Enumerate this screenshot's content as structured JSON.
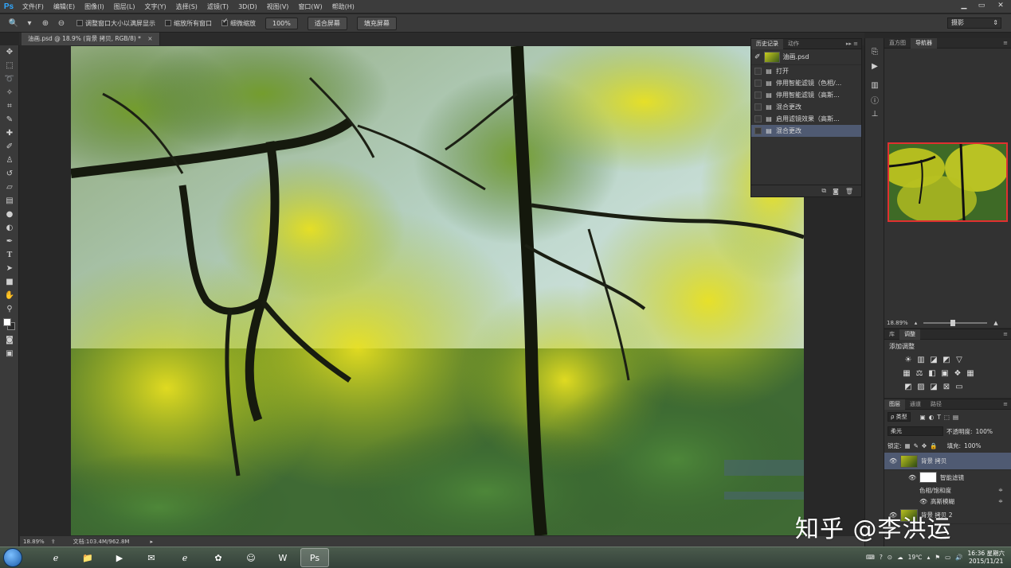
{
  "app": {
    "logo": "Ps",
    "menu": [
      "文件(F)",
      "编辑(E)",
      "图像(I)",
      "图层(L)",
      "文字(Y)",
      "选择(S)",
      "滤镜(T)",
      "3D(D)",
      "视图(V)",
      "窗口(W)",
      "帮助(H)"
    ],
    "window_controls": [
      "▁",
      "▭",
      "✕"
    ]
  },
  "options": {
    "tool_icon": "zoom-icon",
    "resize_windows_label": "调整窗口大小以满屏显示",
    "resize_windows_checked": false,
    "zoom_all_label": "缩放所有窗口",
    "zoom_all_checked": false,
    "scrubby_zoom_label": "细微缩放",
    "scrubby_zoom_checked": true,
    "btn_100": "100%",
    "btn_fit": "适合屏幕",
    "btn_fill": "填充屏幕",
    "workspace": "摄影"
  },
  "document": {
    "tab_title": "油画.psd @ 18.9% (背景 拷贝, RGB/8) *",
    "close": "×"
  },
  "status": {
    "zoom": "18.89%",
    "doc_size": "文档:103.4M/962.8M"
  },
  "history": {
    "tabs": [
      "历史记录",
      "动作"
    ],
    "snapshot": "油画.psd",
    "items": [
      {
        "label": "打开",
        "active": false
      },
      {
        "label": "停用智能滤镜（色相/...",
        "active": false
      },
      {
        "label": "停用智能滤镜（高斯...",
        "active": false
      },
      {
        "label": "混合更改",
        "active": false
      },
      {
        "label": "启用滤镜效果（高斯...",
        "active": false
      },
      {
        "label": "混合更改",
        "active": true
      }
    ]
  },
  "navigator": {
    "tabs": [
      "直方图",
      "导航器"
    ],
    "zoom": "18.89%"
  },
  "adjustments": {
    "tabs": [
      "库",
      "调整"
    ],
    "title": "添加调整"
  },
  "layers": {
    "tabs": [
      "图层",
      "通道",
      "路径"
    ],
    "filter_kind": "ρ 类型",
    "blend_mode": "柔光",
    "opacity_label": "不透明度:",
    "opacity": "100%",
    "lock_label": "锁定:",
    "fill_label": "填充:",
    "fill": "100%",
    "items": {
      "main": "背景 拷贝",
      "smart_filters": "智能滤镜",
      "filter1": "色相/饱和度",
      "filter2": "高斯模糊",
      "second": "背景 拷贝 2"
    }
  },
  "watermark": "知乎 @李洪运",
  "taskbar": {
    "weather": "19℃",
    "time": "16:36 星期六",
    "date": "2015/11/21"
  },
  "colors": {
    "accent": "#31a8ff",
    "selection": "#4f5a72",
    "navigator_frame": "#e03030"
  }
}
